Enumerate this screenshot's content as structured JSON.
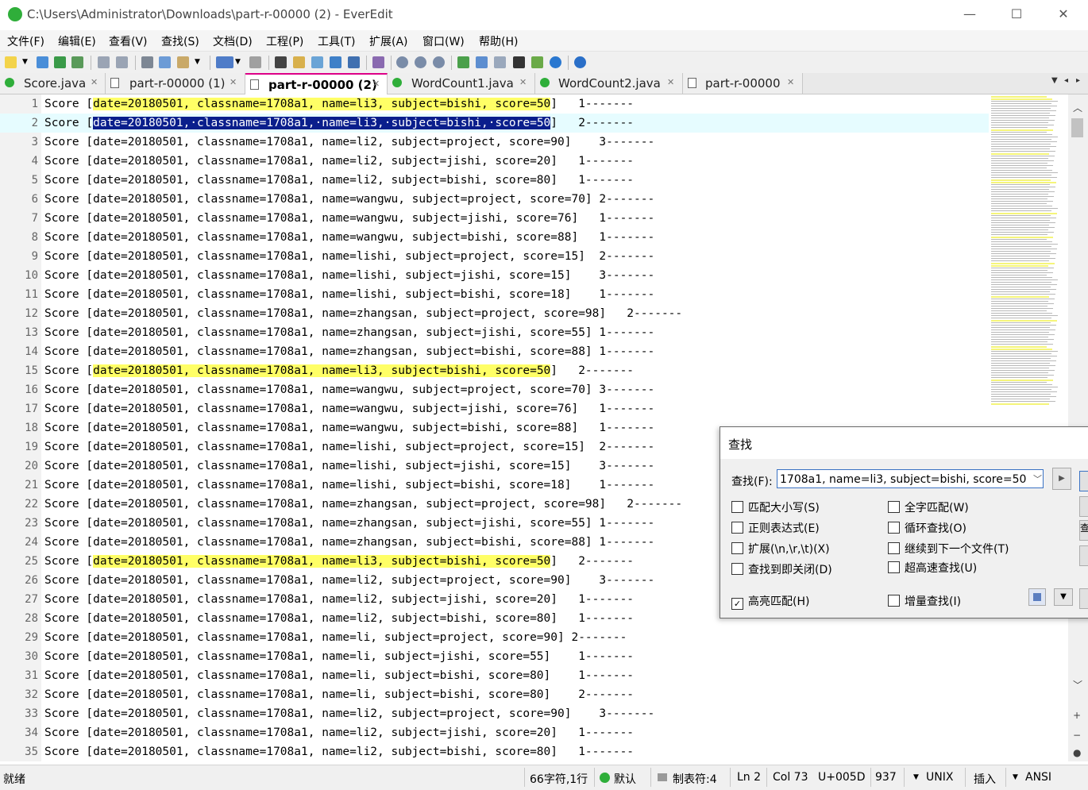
{
  "window": {
    "title": "C:\\Users\\Administrator\\Downloads\\part-r-00000 (2) - EverEdit",
    "minimize": "—",
    "maximize": "☐",
    "close": "✕"
  },
  "menu": [
    "文件(F)",
    "编辑(E)",
    "查看(V)",
    "查找(S)",
    "文档(D)",
    "工程(P)",
    "工具(T)",
    "扩展(A)",
    "窗口(W)",
    "帮助(H)"
  ],
  "tabs": [
    {
      "label": "Score.java",
      "icon": "java-file-icon",
      "active": false
    },
    {
      "label": "part-r-00000 (1)",
      "icon": "file-icon",
      "active": false
    },
    {
      "label": "part-r-00000 (2)",
      "icon": "file-icon",
      "active": true
    },
    {
      "label": "WordCount1.java",
      "icon": "java-file-icon",
      "active": false
    },
    {
      "label": "WordCount2.java",
      "icon": "java-file-icon",
      "active": false
    },
    {
      "label": "part-r-00000",
      "icon": "file-icon",
      "active": false
    }
  ],
  "tab_close": "✕",
  "editor": {
    "current_line": 2,
    "highlight_text": "date=20180501, classname=1708a1, name=li3, subject=bishi, score=50",
    "lines": [
      {
        "n": "1",
        "pre": "Score [",
        "hl": "date=20180501, classname=1708a1, name=li3, subject=bishi, score=50",
        "post": "]   1-------"
      },
      {
        "n": "2",
        "pre": "Score [",
        "sel": "date=20180501,·classname=1708a1,·name=li3,·subject=bishi,·score=50",
        "post": "]   2-------"
      },
      {
        "n": "3",
        "pre": "Score [date=20180501, classname=1708a1, name=li2, subject=project, score=90]    3-------"
      },
      {
        "n": "4",
        "pre": "Score [date=20180501, classname=1708a1, name=li2, subject=jishi, score=20]   1-------"
      },
      {
        "n": "5",
        "pre": "Score [date=20180501, classname=1708a1, name=li2, subject=bishi, score=80]   1-------"
      },
      {
        "n": "6",
        "pre": "Score [date=20180501, classname=1708a1, name=wangwu, subject=project, score=70] 2-------"
      },
      {
        "n": "7",
        "pre": "Score [date=20180501, classname=1708a1, name=wangwu, subject=jishi, score=76]   1-------"
      },
      {
        "n": "8",
        "pre": "Score [date=20180501, classname=1708a1, name=wangwu, subject=bishi, score=88]   1-------"
      },
      {
        "n": "9",
        "pre": "Score [date=20180501, classname=1708a1, name=lishi, subject=project, score=15]  2-------"
      },
      {
        "n": "10",
        "pre": "Score [date=20180501, classname=1708a1, name=lishi, subject=jishi, score=15]    3-------"
      },
      {
        "n": "11",
        "pre": "Score [date=20180501, classname=1708a1, name=lishi, subject=bishi, score=18]    1-------"
      },
      {
        "n": "12",
        "pre": "Score [date=20180501, classname=1708a1, name=zhangsan, subject=project, score=98]   2-------"
      },
      {
        "n": "13",
        "pre": "Score [date=20180501, classname=1708a1, name=zhangsan, subject=jishi, score=55] 1-------"
      },
      {
        "n": "14",
        "pre": "Score [date=20180501, classname=1708a1, name=zhangsan, subject=bishi, score=88] 1-------"
      },
      {
        "n": "15",
        "pre": "Score [",
        "hl": "date=20180501, classname=1708a1, name=li3, subject=bishi, score=50",
        "post": "]   2-------"
      },
      {
        "n": "16",
        "pre": "Score [date=20180501, classname=1708a1, name=wangwu, subject=project, score=70] 3-------"
      },
      {
        "n": "17",
        "pre": "Score [date=20180501, classname=1708a1, name=wangwu, subject=jishi, score=76]   1-------"
      },
      {
        "n": "18",
        "pre": "Score [date=20180501, classname=1708a1, name=wangwu, subject=bishi, score=88]   1-------"
      },
      {
        "n": "19",
        "pre": "Score [date=20180501, classname=1708a1, name=lishi, subject=project, score=15]  2-------"
      },
      {
        "n": "20",
        "pre": "Score [date=20180501, classname=1708a1, name=lishi, subject=jishi, score=15]    3-------"
      },
      {
        "n": "21",
        "pre": "Score [date=20180501, classname=1708a1, name=lishi, subject=bishi, score=18]    1-------"
      },
      {
        "n": "22",
        "pre": "Score [date=20180501, classname=1708a1, name=zhangsan, subject=project, score=98]   2-------"
      },
      {
        "n": "23",
        "pre": "Score [date=20180501, classname=1708a1, name=zhangsan, subject=jishi, score=55] 1-------"
      },
      {
        "n": "24",
        "pre": "Score [date=20180501, classname=1708a1, name=zhangsan, subject=bishi, score=88] 1-------"
      },
      {
        "n": "25",
        "pre": "Score [",
        "hl": "date=20180501, classname=1708a1, name=li3, subject=bishi, score=50",
        "post": "]   2-------"
      },
      {
        "n": "26",
        "pre": "Score [date=20180501, classname=1708a1, name=li2, subject=project, score=90]    3-------"
      },
      {
        "n": "27",
        "pre": "Score [date=20180501, classname=1708a1, name=li2, subject=jishi, score=20]   1-------"
      },
      {
        "n": "28",
        "pre": "Score [date=20180501, classname=1708a1, name=li2, subject=bishi, score=80]   1-------"
      },
      {
        "n": "29",
        "pre": "Score [date=20180501, classname=1708a1, name=li, subject=project, score=90] 2-------"
      },
      {
        "n": "30",
        "pre": "Score [date=20180501, classname=1708a1, name=li, subject=jishi, score=55]    1-------"
      },
      {
        "n": "31",
        "pre": "Score [date=20180501, classname=1708a1, name=li, subject=bishi, score=80]    1-------"
      },
      {
        "n": "32",
        "pre": "Score [date=20180501, classname=1708a1, name=li, subject=bishi, score=80]    2-------"
      },
      {
        "n": "33",
        "pre": "Score [date=20180501, classname=1708a1, name=li2, subject=project, score=90]    3-------"
      },
      {
        "n": "34",
        "pre": "Score [date=20180501, classname=1708a1, name=li2, subject=jishi, score=20]   1-------"
      },
      {
        "n": "35",
        "pre": "Score [date=20180501, classname=1708a1, name=li2, subject=bishi, score=80]   1-------"
      }
    ]
  },
  "find_dialog": {
    "title": "查找",
    "find_label": "查找(F):",
    "find_value": "1708a1, name=li3, subject=bishi, score=50",
    "options": [
      {
        "label": "匹配大小写(S)",
        "checked": false
      },
      {
        "label": "全字匹配(W)",
        "checked": false
      },
      {
        "label": "正则表达式(E)",
        "checked": false
      },
      {
        "label": "循环查找(O)",
        "checked": false
      },
      {
        "label": "扩展(\\n,\\r,\\t)(X)",
        "checked": false
      },
      {
        "label": "继续到下一个文件(T)",
        "checked": false
      },
      {
        "label": "查找到即关闭(D)",
        "checked": false
      },
      {
        "label": "超高速查找(U)",
        "checked": false
      },
      {
        "label": "高亮匹配(H)",
        "checked": true
      },
      {
        "label": "增量查找(I)",
        "checked": false
      }
    ],
    "side_button_char": "查"
  },
  "statusbar": {
    "ready": "就绪",
    "chars": "66字符,1行",
    "scheme": "默认",
    "tab": "制表符:4",
    "ln": "Ln 2",
    "col": "Col 73",
    "unicode": "U+005D",
    "num": "937",
    "eol": "UNIX",
    "mode": "插入",
    "encoding": "ANSI"
  },
  "colors": {
    "highlight": "#ffff66",
    "selection": "#0a1e8c",
    "current_line": "#e6fcff",
    "gutter": "#f2f2f2",
    "app_icon": "#2fae3a",
    "active_tab_border": "#dd0088"
  }
}
